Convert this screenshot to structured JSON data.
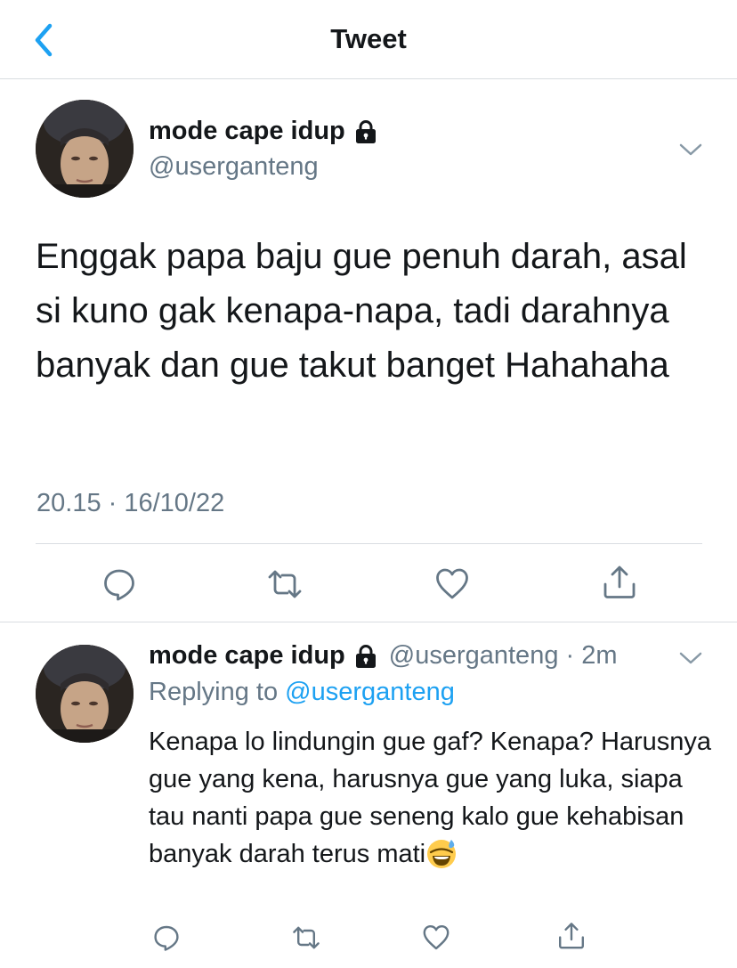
{
  "header": {
    "title": "Tweet",
    "back_icon": "chevron-left-icon"
  },
  "colors": {
    "accent": "#1da1f2",
    "text": "#14171a",
    "secondary": "#657786",
    "divider": "#d9dde1"
  },
  "main_tweet": {
    "display_name": "mode cape idup",
    "handle": "@userganteng",
    "text": "Enggak papa baju gue penuh darah, asal si kuno gak kenapa-napa, tadi darahnya banyak dan gue takut banget Hahahaha",
    "timestamp": "20.15 · 16/10/22",
    "actions": [
      "reply-icon",
      "retweet-icon",
      "like-icon",
      "share-icon"
    ]
  },
  "reply_tweet": {
    "display_name": "mode cape idup",
    "handle_time": "@userganteng · 2m",
    "replying_prefix": "Replying to ",
    "replying_to": "@userganteng",
    "text": "Kenapa lo lindungin gue gaf? Kenapa? Harusnya gue yang kena, harusnya gue yang luka, siapa tau nanti papa gue seneng kalo gue kehabisan banyak darah terus mati",
    "emoji": "grinning-sweat-emoji"
  }
}
